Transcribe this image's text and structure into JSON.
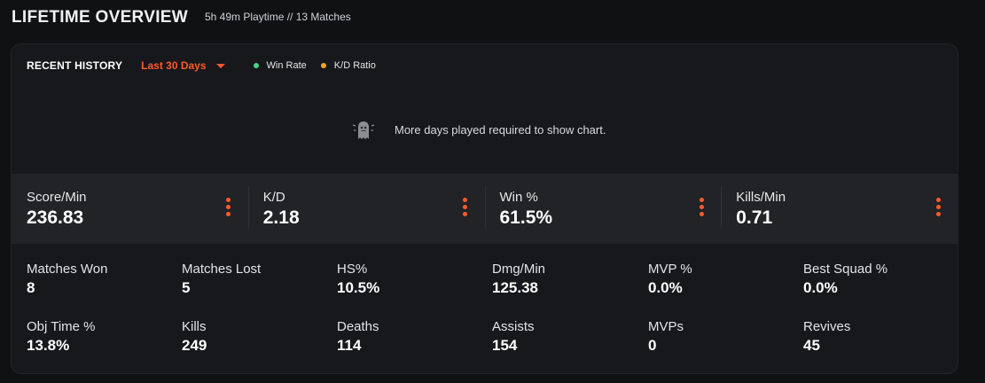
{
  "header": {
    "title": "LIFETIME OVERVIEW",
    "subtitle": "5h 49m Playtime // 13 Matches"
  },
  "history": {
    "title": "RECENT HISTORY",
    "range": "Last 30 Days",
    "legend": [
      {
        "label": "Win Rate",
        "color": "#3ddc84"
      },
      {
        "label": "K/D Ratio",
        "color": "#f5a623"
      }
    ],
    "empty_message": "More days played required to show chart."
  },
  "highlights": [
    {
      "label": "Score/Min",
      "value": "236.83"
    },
    {
      "label": "K/D",
      "value": "2.18"
    },
    {
      "label": "Win %",
      "value": "61.5%"
    },
    {
      "label": "Kills/Min",
      "value": "0.71"
    }
  ],
  "stats": [
    [
      {
        "label": "Matches Won",
        "value": "8"
      },
      {
        "label": "Matches Lost",
        "value": "5"
      },
      {
        "label": "HS%",
        "value": "10.5%"
      },
      {
        "label": "Dmg/Min",
        "value": "125.38"
      },
      {
        "label": "MVP %",
        "value": "0.0%"
      },
      {
        "label": "Best Squad %",
        "value": "0.0%"
      }
    ],
    [
      {
        "label": "Obj Time %",
        "value": "13.8%"
      },
      {
        "label": "Kills",
        "value": "249"
      },
      {
        "label": "Deaths",
        "value": "114"
      },
      {
        "label": "Assists",
        "value": "154"
      },
      {
        "label": "MVPs",
        "value": "0"
      },
      {
        "label": "Revives",
        "value": "45"
      }
    ]
  ],
  "colors": {
    "accent": "#ff5a2b",
    "card_bg": "#17181b",
    "highlight_bg": "#222326"
  }
}
